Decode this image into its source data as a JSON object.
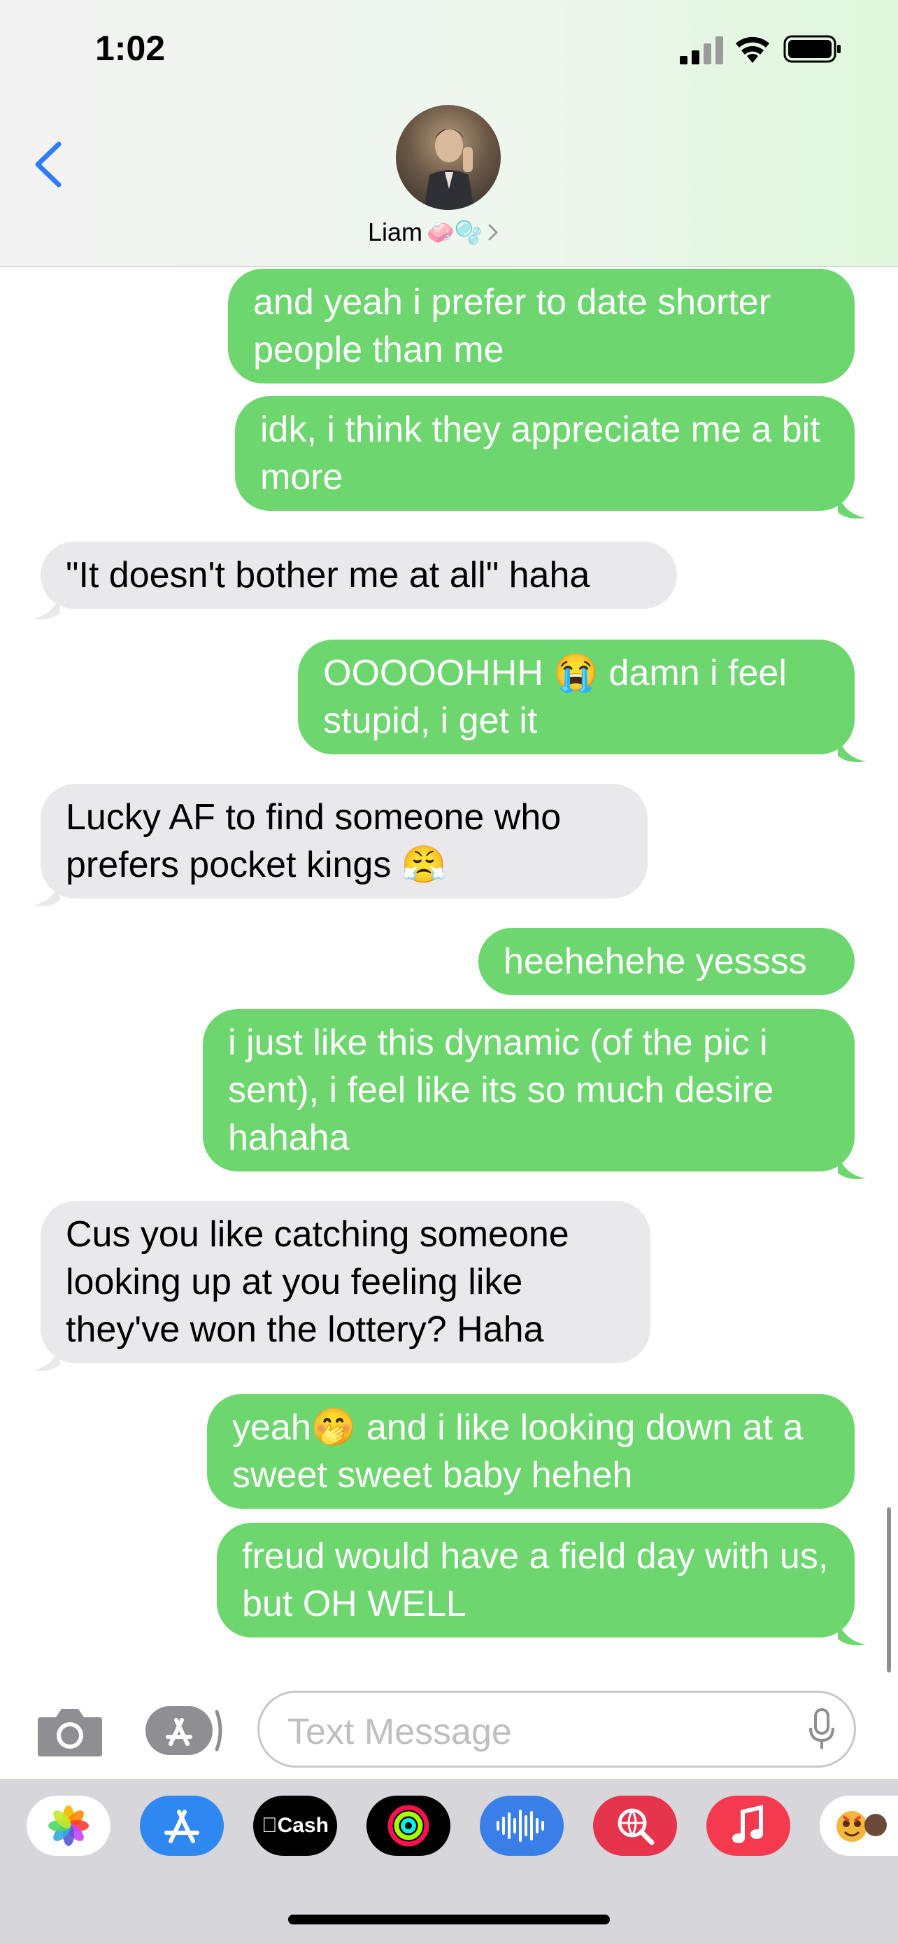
{
  "status_bar": {
    "time": "1:02"
  },
  "header": {
    "contact_name": "Liam",
    "contact_emojis": "🧼🫧"
  },
  "messages": [
    {
      "dir": "out",
      "text": "and yeah i prefer to date shorter people than me"
    },
    {
      "dir": "out",
      "text": "idk, i think they appreciate me a bit more"
    },
    {
      "dir": "in",
      "text": "\"It doesn't bother me at all\" haha"
    },
    {
      "dir": "out",
      "text": "OOOOOHHH 😭 damn i feel stupid, i get it"
    },
    {
      "dir": "in",
      "text": "Lucky AF to find someone who prefers pocket kings 😤"
    },
    {
      "dir": "out",
      "text": "heehehehe yessss"
    },
    {
      "dir": "out",
      "text": "i just like this dynamic (of the pic i sent), i feel like its so much desire hahaha"
    },
    {
      "dir": "in",
      "text": "Cus you like catching someone looking up at you feeling like they've won the lottery? Haha"
    },
    {
      "dir": "out",
      "text": "yeah🤭 and i like looking down at a sweet sweet baby heheh"
    },
    {
      "dir": "out",
      "text": "freud would have a field day with us, but OH WELL"
    }
  ],
  "input": {
    "placeholder": "Text Message"
  },
  "app_drawer": [
    {
      "name": "photos-app",
      "icon": "photos-icon"
    },
    {
      "name": "app-store-app",
      "icon": "app-store-icon"
    },
    {
      "name": "cash-app",
      "icon": "cash-icon",
      "label": "Cash"
    },
    {
      "name": "fitness-app",
      "icon": "activity-rings-icon"
    },
    {
      "name": "voice-memo-app",
      "icon": "waveform-icon"
    },
    {
      "name": "image-search-app",
      "icon": "globe-search-icon"
    },
    {
      "name": "music-app",
      "icon": "music-note-icon"
    },
    {
      "name": "memoji-app",
      "icon": "memoji-icon"
    }
  ],
  "colors": {
    "outgoing": "#6dd66e",
    "incoming": "#e9e9eb",
    "accent": "#2f7cf6"
  }
}
